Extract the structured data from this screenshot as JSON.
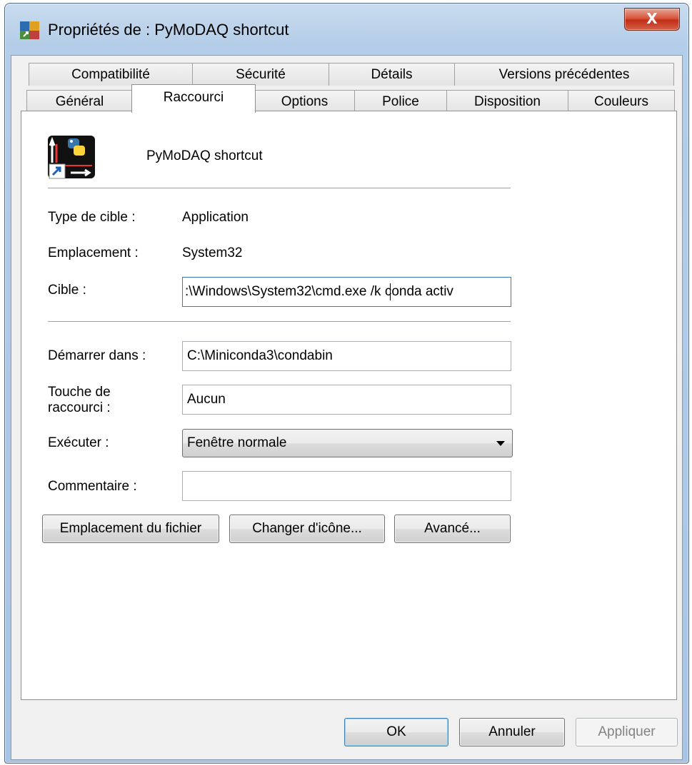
{
  "window": {
    "title": "Propriétés de : PyMoDAQ shortcut",
    "close_label": "X"
  },
  "tabs": {
    "row_top": [
      "Compatibilité",
      "Sécurité",
      "Détails",
      "Versions précédentes"
    ],
    "row_bottom": [
      "Général",
      "Raccourci",
      "Options",
      "Police",
      "Disposition",
      "Couleurs"
    ],
    "active": "Raccourci"
  },
  "shortcut": {
    "name": "PyMoDAQ shortcut",
    "icon": "pymodaq-shortcut-icon"
  },
  "fields": {
    "target_type_label": "Type de cible :",
    "target_type_value": "Application",
    "location_label": "Emplacement :",
    "location_value": "System32",
    "target_label": "Cible :",
    "target_value": ":\\Windows\\System32\\cmd.exe /k conda activ",
    "start_in_label": "Démarrer dans :",
    "start_in_value": "C:\\Miniconda3\\condabin",
    "hotkey_label_1": "Touche de",
    "hotkey_label_2": "raccourci :",
    "hotkey_value": "Aucun",
    "run_label": "Exécuter :",
    "run_value": "Fenêtre normale",
    "comment_label": "Commentaire :",
    "comment_value": ""
  },
  "buttons": {
    "open_location": "Emplacement du fichier",
    "change_icon": "Changer d'icône...",
    "advanced": "Avancé...",
    "ok": "OK",
    "cancel": "Annuler",
    "apply": "Appliquer"
  }
}
